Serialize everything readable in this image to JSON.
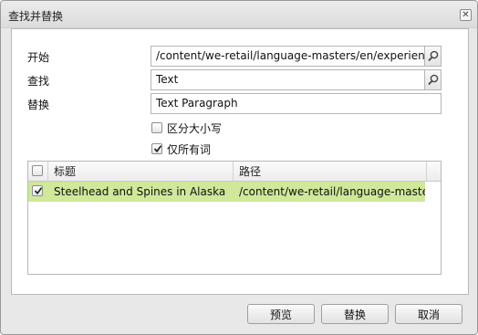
{
  "dialog": {
    "title": "查找并替换",
    "close_glyph": "✕"
  },
  "form": {
    "start_label": "开始",
    "start_value": "/content/we-retail/language-masters/en/experience",
    "find_label": "查找",
    "find_value": "Text",
    "replace_label": "替换",
    "replace_value": "Text Paragraph",
    "case_sensitive_label": "区分大小写",
    "case_sensitive_checked": false,
    "whole_words_label": "仅所有词",
    "whole_words_checked": true
  },
  "grid": {
    "columns": [
      "标题",
      "路径"
    ],
    "rows": [
      {
        "checked": true,
        "title": "Steelhead and Spines in Alaska",
        "path": "/content/we-retail/language-masters..."
      }
    ],
    "selected_row_color": "#cfe89a"
  },
  "footer": {
    "preview_label": "预览",
    "replace_label": "替换",
    "cancel_label": "取消"
  },
  "icons": {
    "search": "search-icon",
    "check": "check-icon",
    "close": "close-icon"
  }
}
